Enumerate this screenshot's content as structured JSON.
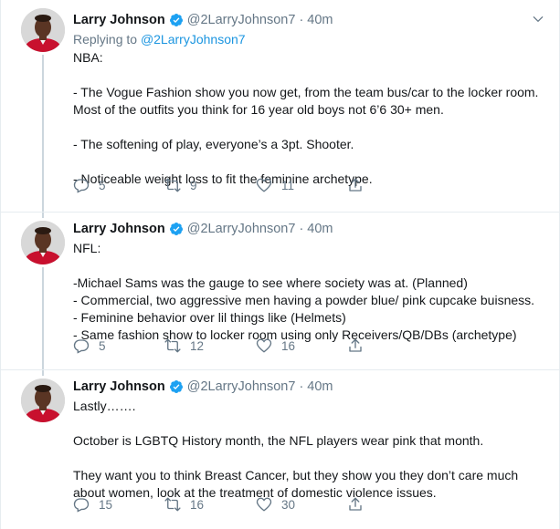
{
  "tweets": [
    {
      "author": {
        "name": "Larry Johnson",
        "handle": "@2LarryJohnson7",
        "time": "40m"
      },
      "replying_label": "Replying to",
      "replying_mention": "@2LarryJohnson7",
      "text": "NBA:\n\n- The Vogue Fashion show you now get, from the team bus/car to the locker room. Most of the outfits you think for 16 year old boys not 6’6 30+ men.\n\n- The softening of play, everyone’s a 3pt. Shooter.\n\n- Noticeable weight loss to fit the feminine archetype.",
      "replies": "5",
      "retweets": "9",
      "likes": "11"
    },
    {
      "author": {
        "name": "Larry Johnson",
        "handle": "@2LarryJohnson7",
        "time": "40m"
      },
      "text": "NFL:\n\n-Michael Sams was the gauge to see where society was at. (Planned)\n- Commercial, two aggressive men having a powder blue/ pink cupcake buisness.\n- Feminine behavior over lil things like (Helmets)\n- Same fashion show to locker room using only Receivers/QB/DBs (archetype)",
      "replies": "5",
      "retweets": "12",
      "likes": "16"
    },
    {
      "author": {
        "name": "Larry Johnson",
        "handle": "@2LarryJohnson7",
        "time": "40m"
      },
      "text": "Lastly…….\n\nOctober is LGBTQ History month, the NFL players wear pink that month.\n\nThey want you to think Breast Cancer, but they show you they don’t care much about women, look at the treatment of domestic violence issues.",
      "replies": "15",
      "retweets": "16",
      "likes": "30"
    }
  ],
  "separator": "·",
  "colors": {
    "text": "#14171a",
    "muted": "#657786",
    "link": "#1b95e0",
    "verified": "#1da1f2",
    "thread_line": "#ccd6dd"
  },
  "icons": [
    "avatar",
    "verified-badge-icon",
    "chevron-down-icon",
    "reply-icon",
    "retweet-icon",
    "like-icon",
    "share-icon"
  ]
}
